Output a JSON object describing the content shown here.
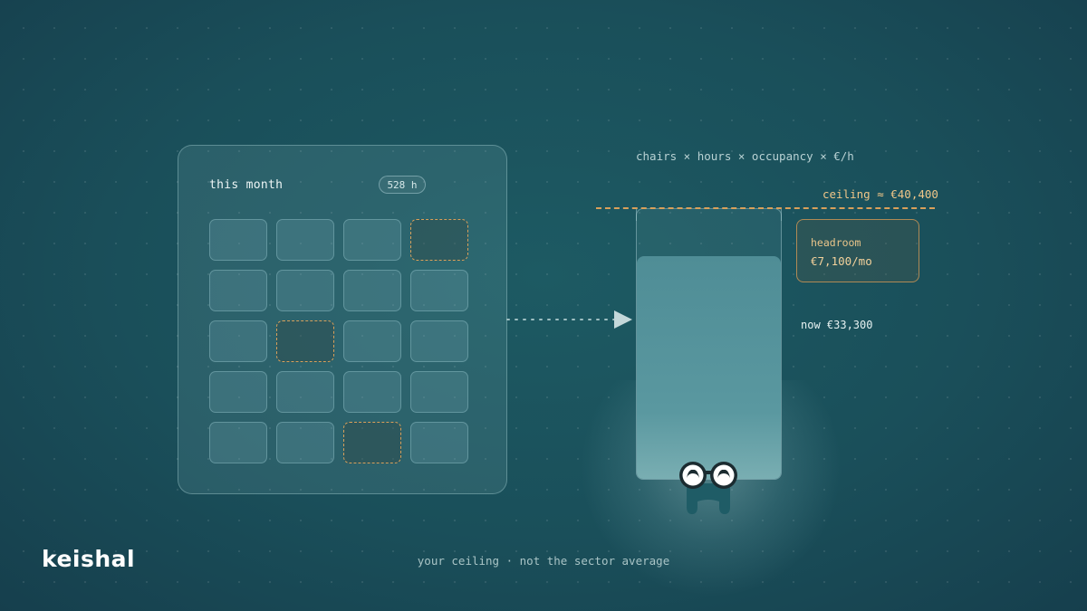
{
  "panel": {
    "title": "this month",
    "hours_badge": "528 h",
    "grid": [
      [
        "on",
        "on",
        "on",
        "off"
      ],
      [
        "on",
        "on",
        "on",
        "on"
      ],
      [
        "on",
        "off",
        "on",
        "on"
      ],
      [
        "on",
        "on",
        "on",
        "on"
      ],
      [
        "on",
        "on",
        "off",
        "on"
      ]
    ]
  },
  "formula": "chairs × hours × occupancy × €/h",
  "ceiling": {
    "label": "ceiling ≈ €40,400",
    "value": 40400
  },
  "now": {
    "label": "now €33,300",
    "value": 33300
  },
  "headroom": {
    "label": "headroom",
    "value": "€7,100/mo"
  },
  "footer": "your ceiling · not the sector average",
  "brand": "keishal",
  "colors": {
    "accent": "#d9a05a",
    "background": "#1a4f5a",
    "fill": "#5a98a0"
  },
  "icons": [
    "arrow-right-icon",
    "mascot-icon"
  ]
}
